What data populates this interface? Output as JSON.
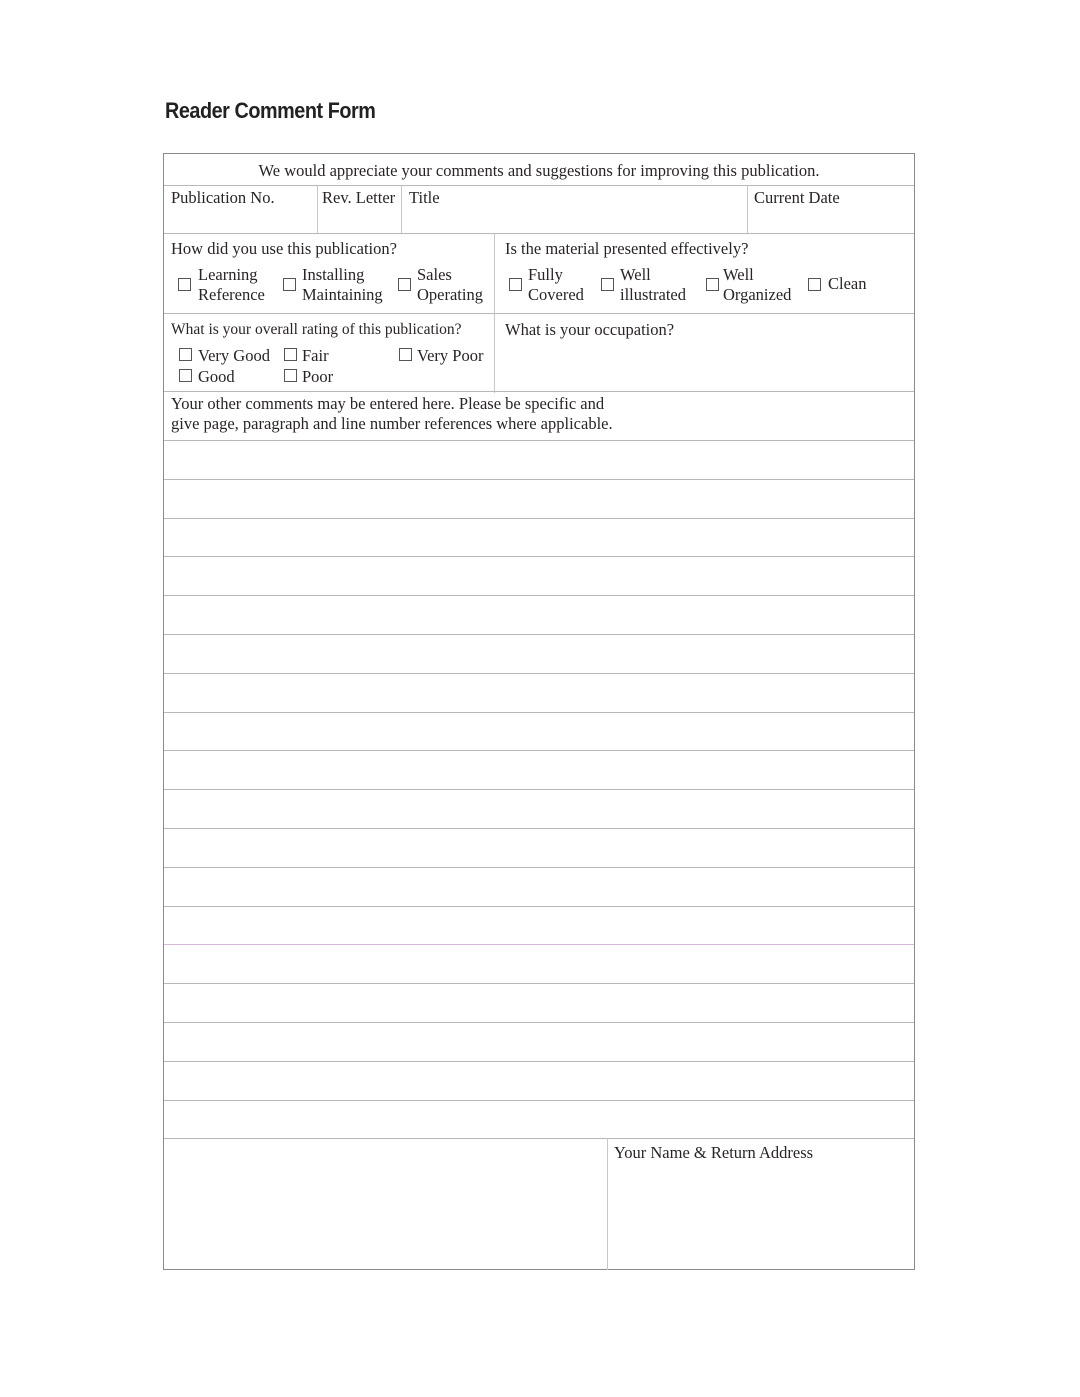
{
  "title": "Reader Comment Form",
  "intro": "We would appreciate your comments and suggestions for improving this publication.",
  "header_fields": {
    "publication_no": "Publication No.",
    "rev_letter": "Rev. Letter",
    "title": "Title",
    "current_date": "Current Date"
  },
  "usage": {
    "question": "How did you use this publication?",
    "options": [
      {
        "line1": "Learning",
        "line2": "Reference"
      },
      {
        "line1": "Installing",
        "line2": "Maintaining"
      },
      {
        "line1": "Sales",
        "line2": "Operating"
      }
    ]
  },
  "effectiveness": {
    "question": "Is the material presented effectively?",
    "options": [
      {
        "line1": "Fully",
        "line2": "Covered"
      },
      {
        "line1": "Well",
        "line2": "illustrated"
      },
      {
        "line1": "Well",
        "line2": "Organized"
      },
      {
        "line1": "Clean",
        "line2": ""
      }
    ]
  },
  "rating": {
    "question": "What is your overall rating of this publication?",
    "options": [
      "Very Good",
      "Fair",
      "Very Poor",
      "Good",
      "Poor"
    ]
  },
  "occupation": {
    "question": "What is your occupation?"
  },
  "comments": {
    "line1": "Your other comments may be entered here.  Please be specific and",
    "line2": "give page, paragraph and line number references where applicable."
  },
  "return_address": "Your Name & Return Address"
}
